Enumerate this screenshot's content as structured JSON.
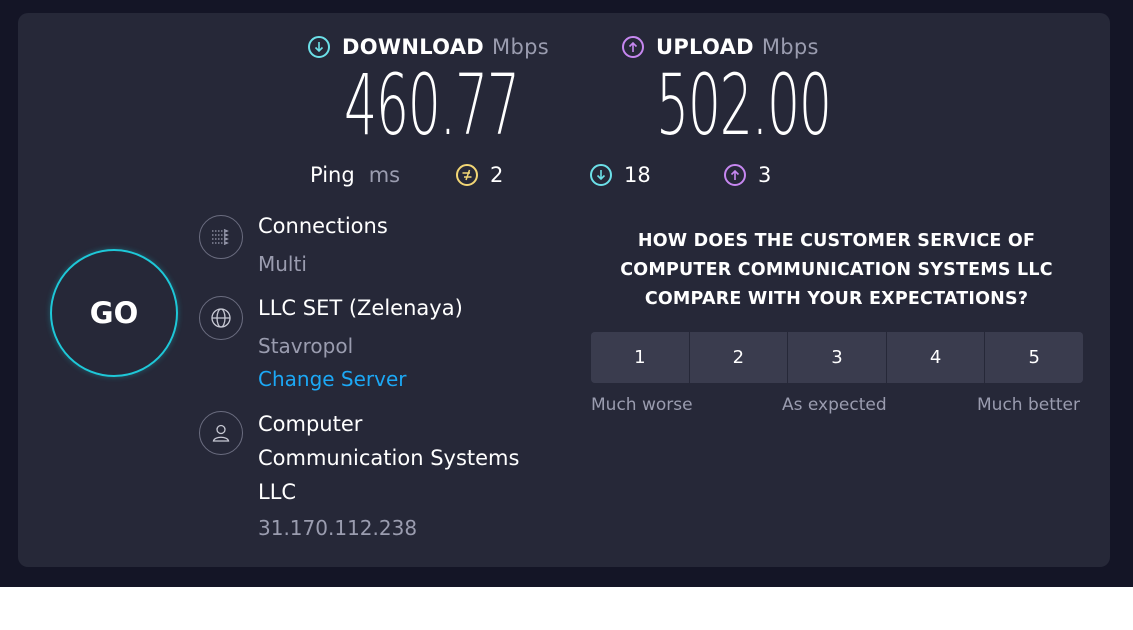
{
  "download": {
    "label": "DOWNLOAD",
    "unit": "Mbps",
    "value": "460.77",
    "icon": "arrow-down-circle-icon",
    "color": "#6ce0e8"
  },
  "upload": {
    "label": "UPLOAD",
    "unit": "Mbps",
    "value": "502.00",
    "icon": "arrow-up-circle-icon",
    "color": "#c687f0"
  },
  "ping": {
    "label": "Ping",
    "unit": "ms",
    "idle": {
      "value": "2",
      "icon": "ping-idle-icon",
      "color": "#f2d675"
    },
    "download": {
      "value": "18",
      "icon": "arrow-down-circle-icon",
      "color": "#6ce0e8"
    },
    "upload": {
      "value": "3",
      "icon": "arrow-up-circle-icon",
      "color": "#c687f0"
    }
  },
  "go_button": {
    "label": "GO"
  },
  "connections": {
    "title": "Connections",
    "value": "Multi",
    "icon": "connections-icon"
  },
  "server": {
    "title": "LLC SET (Zelenaya)",
    "location": "Stavropol",
    "change_label": "Change Server",
    "icon": "globe-icon"
  },
  "provider": {
    "name_lines": [
      "Computer",
      "Communication Systems",
      "LLC"
    ],
    "ip": "31.170.112.238",
    "icon": "user-icon"
  },
  "survey": {
    "question_lines": [
      "HOW DOES THE CUSTOMER SERVICE OF",
      "COMPUTER COMMUNICATION SYSTEMS LLC",
      "COMPARE WITH YOUR EXPECTATIONS?"
    ],
    "options": [
      "1",
      "2",
      "3",
      "4",
      "5"
    ],
    "scale_low": "Much worse",
    "scale_mid": "As expected",
    "scale_high": "Much better"
  },
  "colors": {
    "background": "#141526",
    "panel": "#262838",
    "accent_go": "#1ec8d8",
    "link": "#1ca8f5"
  }
}
